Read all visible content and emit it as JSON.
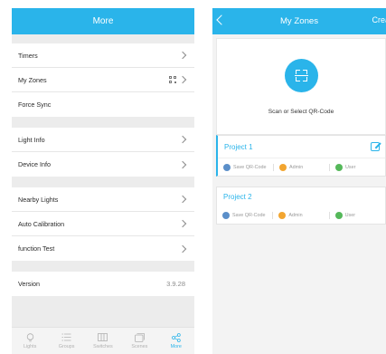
{
  "more_screen": {
    "title": "More",
    "groups": [
      [
        {
          "label": "Timers",
          "trailing": "chevron"
        },
        {
          "label": "My Zones",
          "trailing": "qr-chevron"
        },
        {
          "label": "Force Sync",
          "trailing": "none"
        }
      ],
      [
        {
          "label": "Light Info",
          "trailing": "chevron"
        },
        {
          "label": "Device Info",
          "trailing": "chevron"
        }
      ],
      [
        {
          "label": "Nearby Lights",
          "trailing": "chevron"
        },
        {
          "label": "Auto Calibration",
          "trailing": "chevron"
        },
        {
          "label": "function Test",
          "trailing": "chevron"
        }
      ]
    ],
    "version": {
      "label": "Version",
      "value": "3.9.28"
    },
    "tabs": [
      {
        "label": "Lights",
        "icon": "bulb-icon",
        "active": false
      },
      {
        "label": "Groups",
        "icon": "list-icon",
        "active": false
      },
      {
        "label": "Switches",
        "icon": "switch-icon",
        "active": false
      },
      {
        "label": "Scenes",
        "icon": "scenes-icon",
        "active": false
      },
      {
        "label": "More",
        "icon": "share-icon",
        "active": true
      }
    ]
  },
  "zones_screen": {
    "title": "My Zones",
    "create_label": "Crea",
    "scan_label": "Scan or Select QR-Code",
    "projects": [
      {
        "name": "Project 1",
        "selected": true,
        "actions": [
          {
            "label": "Save QR-Code",
            "color": "#5b8fc9"
          },
          {
            "label": "Admin",
            "color": "#f2a530"
          },
          {
            "label": "User",
            "color": "#55b85a"
          }
        ]
      },
      {
        "name": "Project 2",
        "selected": false,
        "actions": [
          {
            "label": "Save QR-Code",
            "color": "#5b8fc9"
          },
          {
            "label": "Admin",
            "color": "#f2a530"
          },
          {
            "label": "User",
            "color": "#55b85a"
          }
        ]
      }
    ]
  },
  "colors": {
    "accent": "#2ab4ea",
    "background": "#ececec"
  }
}
